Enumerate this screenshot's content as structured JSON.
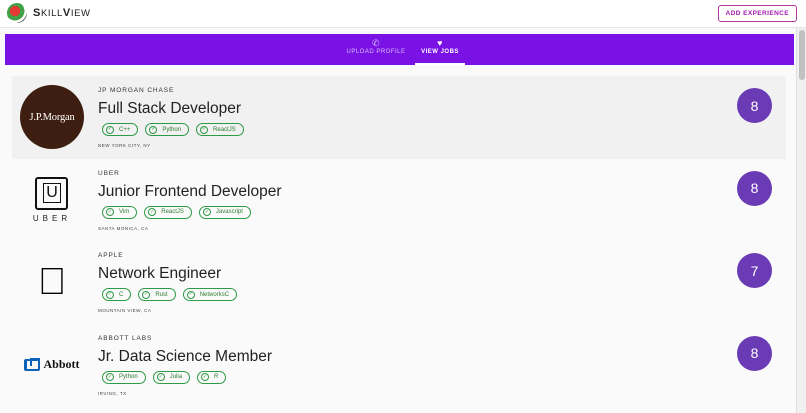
{
  "header": {
    "brand_first": "S",
    "brand_rest": "KILL",
    "brand_first2": "V",
    "brand_rest2": "IEW",
    "add_button": "ADD EXPERIENCE"
  },
  "nav": {
    "tabs": [
      {
        "label": "UPLOAD PROFILE",
        "icon": "phone-icon",
        "active": false
      },
      {
        "label": "VIEW JOBS",
        "icon": "heart-icon",
        "active": true
      }
    ]
  },
  "jobs": [
    {
      "company": "JP MORGAN CHASE",
      "title": "Full Stack Developer",
      "skills": [
        "C++",
        "Python",
        "ReactJS"
      ],
      "location": "NEW YORK CITY, NY",
      "score": "8",
      "logo_text": "J.P.Morgan"
    },
    {
      "company": "UBER",
      "title": "Junior Frontend Developer",
      "skills": [
        "Vim",
        "ReactJS",
        "Javascript"
      ],
      "location": "SANTA MONICA, CA",
      "score": "8",
      "logo_text": "UBER"
    },
    {
      "company": "APPLE",
      "title": "Network Engineer",
      "skills": [
        "C",
        "Rust",
        "NetworksC"
      ],
      "location": "MOUNTAIN VIEW, CA",
      "score": "7",
      "logo_text": ""
    },
    {
      "company": "ABBOTT LABS",
      "title": "Jr. Data Science Member",
      "skills": [
        "Python",
        "Julia",
        "R"
      ],
      "location": "IRVING, TX",
      "score": "8",
      "logo_text": "Abbott"
    }
  ],
  "colors": {
    "nav": "#7a12e6",
    "score": "#6a3bb5",
    "chip": "#2e9a46",
    "accent": "#a21caf"
  }
}
